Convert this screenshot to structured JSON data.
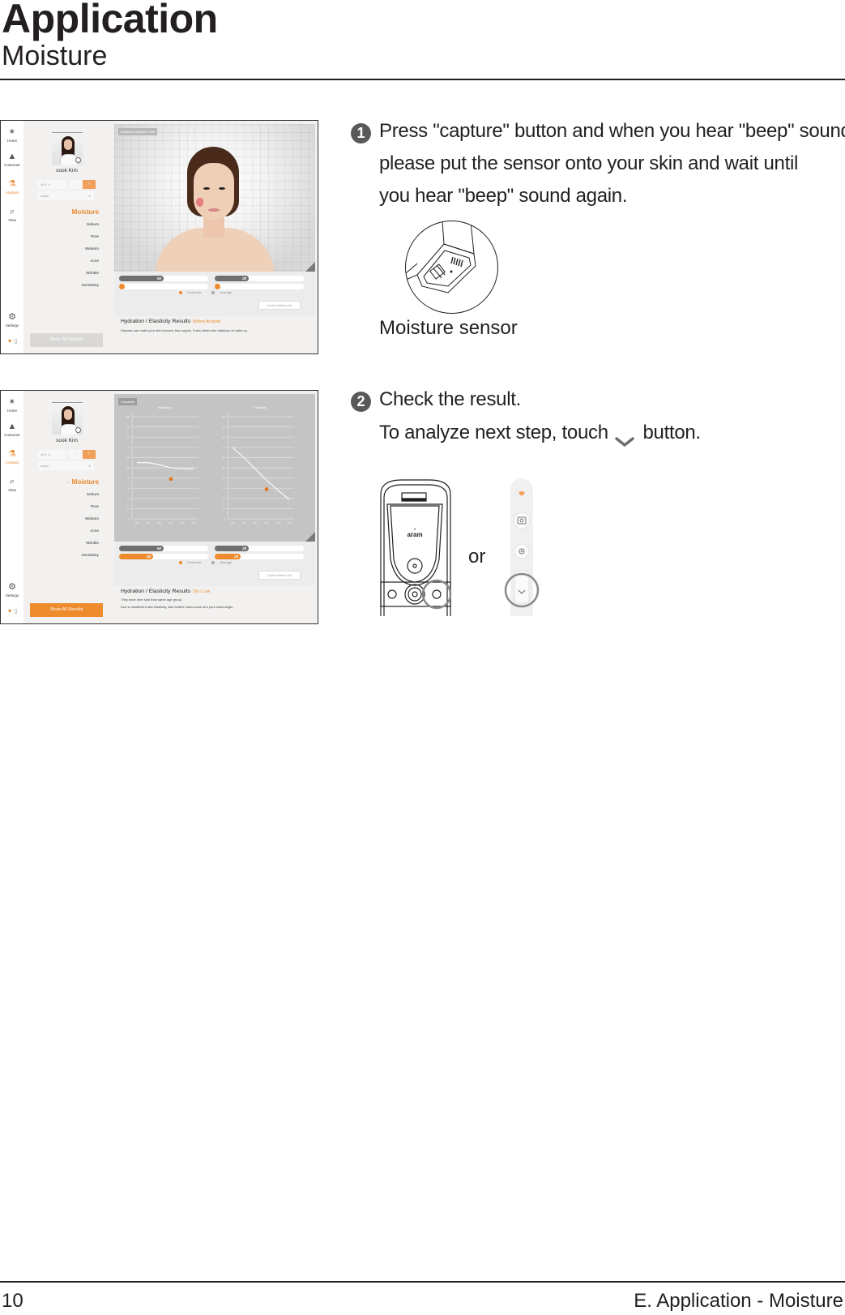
{
  "header": {
    "title": "Application",
    "subtitle": "Moisture"
  },
  "footer": {
    "page_number": "10",
    "section": "E. Application - Moisture"
  },
  "app_common": {
    "rail": [
      {
        "label": "Home",
        "icon": "home-logo-icon"
      },
      {
        "label": "Customer",
        "icon": "customer-icon"
      },
      {
        "label": "Analysis",
        "icon": "microscope-icon",
        "active": true
      },
      {
        "label": "View",
        "icon": "search-icon"
      },
      {
        "label": "Settings",
        "icon": "gear-icon"
      }
    ],
    "user_name": "sook Kim",
    "age_value": "40's",
    "race_value": "Asian",
    "menu": [
      "Moisture",
      "Sebum",
      "Pore",
      "Melanin",
      "Acne",
      "Wrinkle",
      "Sensitivity"
    ],
    "show_all_label": "Show All Results",
    "legend": {
      "customer": "Customer",
      "average": "Average"
    },
    "control_menu_label": "Control Menu On",
    "results_title": "Hydration / Elasticity Results"
  },
  "screenshot1": {
    "viewer_tag": "Moisture Measure Point",
    "bars": {
      "hydration_average": "50",
      "hydration_customer": "0",
      "elasticity_average": "28",
      "elasticity_customer": "0"
    },
    "results_status": "Before Analysis",
    "results_desc": "Dryness can make your skin become less supple.  It also deters the radiance of make up."
  },
  "screenshot2": {
    "viewer_tag": "Complete",
    "bars": {
      "hydration_average": "50",
      "hydration_customer": "38",
      "elasticity_average": "28",
      "elasticity_customer": "29"
    },
    "results_status": "Dry / Low",
    "results_desc_1": "They have drier skin than same age group.",
    "results_desc_2": "Due to insufficient skin elasticity, skin texture looks loose and pore looks larger."
  },
  "chart_data": [
    {
      "type": "line",
      "title": "Hydration",
      "categories": [
        "10's",
        "20's",
        "30's",
        "40's",
        "50's",
        "60's"
      ],
      "series": [
        {
          "name": "Average",
          "values": [
            55,
            55,
            53,
            50,
            49,
            49
          ]
        },
        {
          "name": "Customer",
          "points": [
            {
              "x": "40's",
              "y": 39
            }
          ]
        }
      ],
      "yticks": [
        0,
        10,
        20,
        30,
        40,
        50,
        60,
        70,
        80,
        90,
        100
      ],
      "ylim": [
        0,
        100
      ],
      "grid": true
    },
    {
      "type": "line",
      "title": "Elasticity",
      "categories": [
        "10's",
        "20's",
        "30's",
        "40's",
        "50's",
        "60's"
      ],
      "series": [
        {
          "name": "Average",
          "values": [
            70,
            60,
            49,
            38,
            28,
            19
          ]
        },
        {
          "name": "Customer",
          "points": [
            {
              "x": "40's",
              "y": 29
            }
          ]
        }
      ],
      "yticks": [
        0,
        10,
        20,
        30,
        40,
        50,
        60,
        70,
        80,
        90,
        100
      ],
      "ylim": [
        0,
        100
      ],
      "grid": true
    }
  ],
  "steps": [
    {
      "number": "1",
      "lines": [
        "Press \"capture\" button and when you hear \"beep\" sound,",
        "please put the sensor onto your skin and wait until",
        "you hear \"beep\" sound again."
      ],
      "figure_caption": "Moisture sensor"
    },
    {
      "number": "2",
      "lines": [
        "Check the result."
      ],
      "next_prefix": "To analyze next step, touch",
      "next_suffix": "button.",
      "or_label": "or",
      "device_brand": "aram"
    }
  ]
}
